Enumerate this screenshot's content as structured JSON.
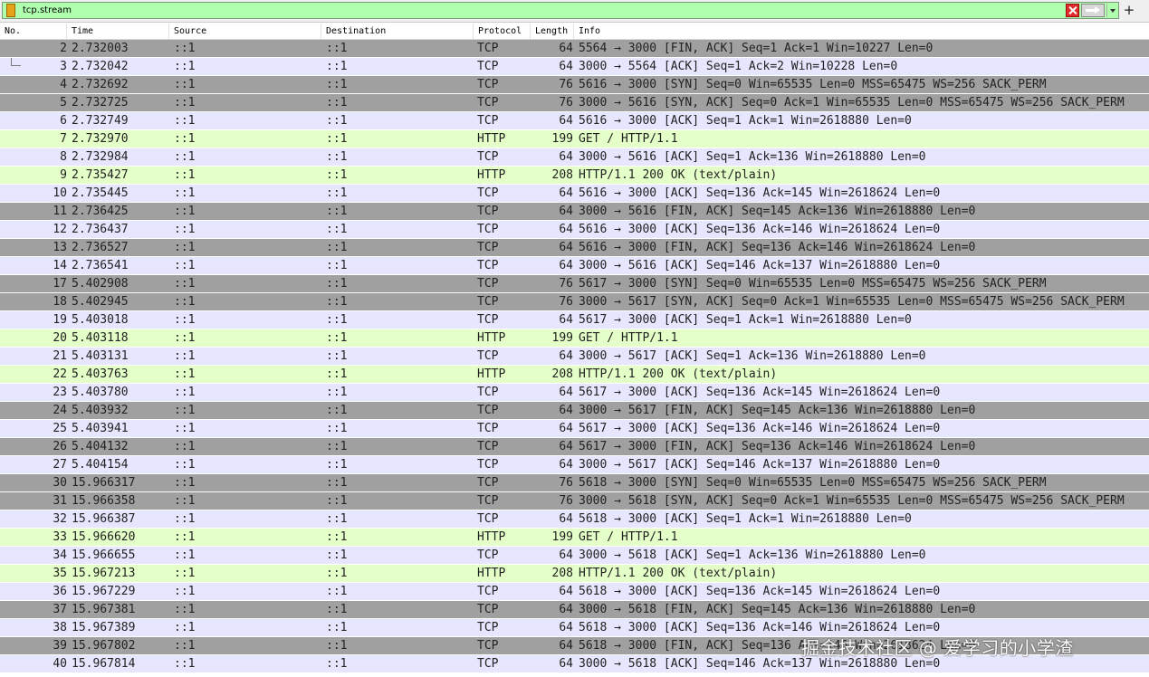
{
  "filter": {
    "value": "tcp.stream",
    "bg": "#afffaf"
  },
  "icons": {
    "bookmark": "bookmark-icon",
    "clear": "clear-filter-icon",
    "apply": "apply-filter-arrow-icon",
    "dropdown": "chevron-down-icon",
    "add": "plus-icon"
  },
  "add_label": "+",
  "columns": [
    "No.",
    "Time",
    "Source",
    "Destination",
    "Protocol",
    "Length",
    "Info"
  ],
  "colors": {
    "tcp_dark": "#a0a0a0",
    "tcp_light": "#e7e6ff",
    "http": "#e4ffc7"
  },
  "packets": [
    {
      "no": "2",
      "time": "2.732003",
      "src": "::1",
      "dst": "::1",
      "proto": "TCP",
      "len": "64",
      "info": "5564 → 3000 [FIN, ACK] Seq=1 Ack=1 Win=10227 Len=0",
      "style": "tcp_dark"
    },
    {
      "no": "3",
      "time": "2.732042",
      "src": "::1",
      "dst": "::1",
      "proto": "TCP",
      "len": "64",
      "info": "3000 → 5564 [ACK] Seq=1 Ack=2 Win=10228 Len=0",
      "style": "tcp_light",
      "tree": true
    },
    {
      "no": "4",
      "time": "2.732692",
      "src": "::1",
      "dst": "::1",
      "proto": "TCP",
      "len": "76",
      "info": "5616 → 3000 [SYN] Seq=0 Win=65535 Len=0 MSS=65475 WS=256 SACK_PERM",
      "style": "tcp_dark"
    },
    {
      "no": "5",
      "time": "2.732725",
      "src": "::1",
      "dst": "::1",
      "proto": "TCP",
      "len": "76",
      "info": "3000 → 5616 [SYN, ACK] Seq=0 Ack=1 Win=65535 Len=0 MSS=65475 WS=256 SACK_PERM",
      "style": "tcp_dark"
    },
    {
      "no": "6",
      "time": "2.732749",
      "src": "::1",
      "dst": "::1",
      "proto": "TCP",
      "len": "64",
      "info": "5616 → 3000 [ACK] Seq=1 Ack=1 Win=2618880 Len=0",
      "style": "tcp_light"
    },
    {
      "no": "7",
      "time": "2.732970",
      "src": "::1",
      "dst": "::1",
      "proto": "HTTP",
      "len": "199",
      "info": "GET / HTTP/1.1",
      "style": "http"
    },
    {
      "no": "8",
      "time": "2.732984",
      "src": "::1",
      "dst": "::1",
      "proto": "TCP",
      "len": "64",
      "info": "3000 → 5616 [ACK] Seq=1 Ack=136 Win=2618880 Len=0",
      "style": "tcp_light"
    },
    {
      "no": "9",
      "time": "2.735427",
      "src": "::1",
      "dst": "::1",
      "proto": "HTTP",
      "len": "208",
      "info": "HTTP/1.1 200 OK  (text/plain)",
      "style": "http"
    },
    {
      "no": "10",
      "time": "2.735445",
      "src": "::1",
      "dst": "::1",
      "proto": "TCP",
      "len": "64",
      "info": "5616 → 3000 [ACK] Seq=136 Ack=145 Win=2618624 Len=0",
      "style": "tcp_light"
    },
    {
      "no": "11",
      "time": "2.736425",
      "src": "::1",
      "dst": "::1",
      "proto": "TCP",
      "len": "64",
      "info": "3000 → 5616 [FIN, ACK] Seq=145 Ack=136 Win=2618880 Len=0",
      "style": "tcp_dark"
    },
    {
      "no": "12",
      "time": "2.736437",
      "src": "::1",
      "dst": "::1",
      "proto": "TCP",
      "len": "64",
      "info": "5616 → 3000 [ACK] Seq=136 Ack=146 Win=2618624 Len=0",
      "style": "tcp_light"
    },
    {
      "no": "13",
      "time": "2.736527",
      "src": "::1",
      "dst": "::1",
      "proto": "TCP",
      "len": "64",
      "info": "5616 → 3000 [FIN, ACK] Seq=136 Ack=146 Win=2618624 Len=0",
      "style": "tcp_dark"
    },
    {
      "no": "14",
      "time": "2.736541",
      "src": "::1",
      "dst": "::1",
      "proto": "TCP",
      "len": "64",
      "info": "3000 → 5616 [ACK] Seq=146 Ack=137 Win=2618880 Len=0",
      "style": "tcp_light"
    },
    {
      "no": "17",
      "time": "5.402908",
      "src": "::1",
      "dst": "::1",
      "proto": "TCP",
      "len": "76",
      "info": "5617 → 3000 [SYN] Seq=0 Win=65535 Len=0 MSS=65475 WS=256 SACK_PERM",
      "style": "tcp_dark"
    },
    {
      "no": "18",
      "time": "5.402945",
      "src": "::1",
      "dst": "::1",
      "proto": "TCP",
      "len": "76",
      "info": "3000 → 5617 [SYN, ACK] Seq=0 Ack=1 Win=65535 Len=0 MSS=65475 WS=256 SACK_PERM",
      "style": "tcp_dark"
    },
    {
      "no": "19",
      "time": "5.403018",
      "src": "::1",
      "dst": "::1",
      "proto": "TCP",
      "len": "64",
      "info": "5617 → 3000 [ACK] Seq=1 Ack=1 Win=2618880 Len=0",
      "style": "tcp_light"
    },
    {
      "no": "20",
      "time": "5.403118",
      "src": "::1",
      "dst": "::1",
      "proto": "HTTP",
      "len": "199",
      "info": "GET / HTTP/1.1",
      "style": "http"
    },
    {
      "no": "21",
      "time": "5.403131",
      "src": "::1",
      "dst": "::1",
      "proto": "TCP",
      "len": "64",
      "info": "3000 → 5617 [ACK] Seq=1 Ack=136 Win=2618880 Len=0",
      "style": "tcp_light"
    },
    {
      "no": "22",
      "time": "5.403763",
      "src": "::1",
      "dst": "::1",
      "proto": "HTTP",
      "len": "208",
      "info": "HTTP/1.1 200 OK  (text/plain)",
      "style": "http"
    },
    {
      "no": "23",
      "time": "5.403780",
      "src": "::1",
      "dst": "::1",
      "proto": "TCP",
      "len": "64",
      "info": "5617 → 3000 [ACK] Seq=136 Ack=145 Win=2618624 Len=0",
      "style": "tcp_light"
    },
    {
      "no": "24",
      "time": "5.403932",
      "src": "::1",
      "dst": "::1",
      "proto": "TCP",
      "len": "64",
      "info": "3000 → 5617 [FIN, ACK] Seq=145 Ack=136 Win=2618880 Len=0",
      "style": "tcp_dark"
    },
    {
      "no": "25",
      "time": "5.403941",
      "src": "::1",
      "dst": "::1",
      "proto": "TCP",
      "len": "64",
      "info": "5617 → 3000 [ACK] Seq=136 Ack=146 Win=2618624 Len=0",
      "style": "tcp_light"
    },
    {
      "no": "26",
      "time": "5.404132",
      "src": "::1",
      "dst": "::1",
      "proto": "TCP",
      "len": "64",
      "info": "5617 → 3000 [FIN, ACK] Seq=136 Ack=146 Win=2618624 Len=0",
      "style": "tcp_dark"
    },
    {
      "no": "27",
      "time": "5.404154",
      "src": "::1",
      "dst": "::1",
      "proto": "TCP",
      "len": "64",
      "info": "3000 → 5617 [ACK] Seq=146 Ack=137 Win=2618880 Len=0",
      "style": "tcp_light"
    },
    {
      "no": "30",
      "time": "15.966317",
      "src": "::1",
      "dst": "::1",
      "proto": "TCP",
      "len": "76",
      "info": "5618 → 3000 [SYN] Seq=0 Win=65535 Len=0 MSS=65475 WS=256 SACK_PERM",
      "style": "tcp_dark"
    },
    {
      "no": "31",
      "time": "15.966358",
      "src": "::1",
      "dst": "::1",
      "proto": "TCP",
      "len": "76",
      "info": "3000 → 5618 [SYN, ACK] Seq=0 Ack=1 Win=65535 Len=0 MSS=65475 WS=256 SACK_PERM",
      "style": "tcp_dark"
    },
    {
      "no": "32",
      "time": "15.966387",
      "src": "::1",
      "dst": "::1",
      "proto": "TCP",
      "len": "64",
      "info": "5618 → 3000 [ACK] Seq=1 Ack=1 Win=2618880 Len=0",
      "style": "tcp_light"
    },
    {
      "no": "33",
      "time": "15.966620",
      "src": "::1",
      "dst": "::1",
      "proto": "HTTP",
      "len": "199",
      "info": "GET / HTTP/1.1",
      "style": "http"
    },
    {
      "no": "34",
      "time": "15.966655",
      "src": "::1",
      "dst": "::1",
      "proto": "TCP",
      "len": "64",
      "info": "3000 → 5618 [ACK] Seq=1 Ack=136 Win=2618880 Len=0",
      "style": "tcp_light"
    },
    {
      "no": "35",
      "time": "15.967213",
      "src": "::1",
      "dst": "::1",
      "proto": "HTTP",
      "len": "208",
      "info": "HTTP/1.1 200 OK  (text/plain)",
      "style": "http"
    },
    {
      "no": "36",
      "time": "15.967229",
      "src": "::1",
      "dst": "::1",
      "proto": "TCP",
      "len": "64",
      "info": "5618 → 3000 [ACK] Seq=136 Ack=145 Win=2618624 Len=0",
      "style": "tcp_light"
    },
    {
      "no": "37",
      "time": "15.967381",
      "src": "::1",
      "dst": "::1",
      "proto": "TCP",
      "len": "64",
      "info": "3000 → 5618 [FIN, ACK] Seq=145 Ack=136 Win=2618880 Len=0",
      "style": "tcp_dark"
    },
    {
      "no": "38",
      "time": "15.967389",
      "src": "::1",
      "dst": "::1",
      "proto": "TCP",
      "len": "64",
      "info": "5618 → 3000 [ACK] Seq=136 Ack=146 Win=2618624 Len=0",
      "style": "tcp_light"
    },
    {
      "no": "39",
      "time": "15.967802",
      "src": "::1",
      "dst": "::1",
      "proto": "TCP",
      "len": "64",
      "info": "5618 → 3000 [FIN, ACK] Seq=136 Ack=146 Win=2618624 Len=0",
      "style": "tcp_dark"
    },
    {
      "no": "40",
      "time": "15.967814",
      "src": "::1",
      "dst": "::1",
      "proto": "TCP",
      "len": "64",
      "info": "3000 → 5618 [ACK] Seq=146 Ack=137 Win=2618880 Len=0",
      "style": "tcp_light"
    }
  ],
  "watermark": "掘金技术社区 @ 爱学习的小学渣"
}
